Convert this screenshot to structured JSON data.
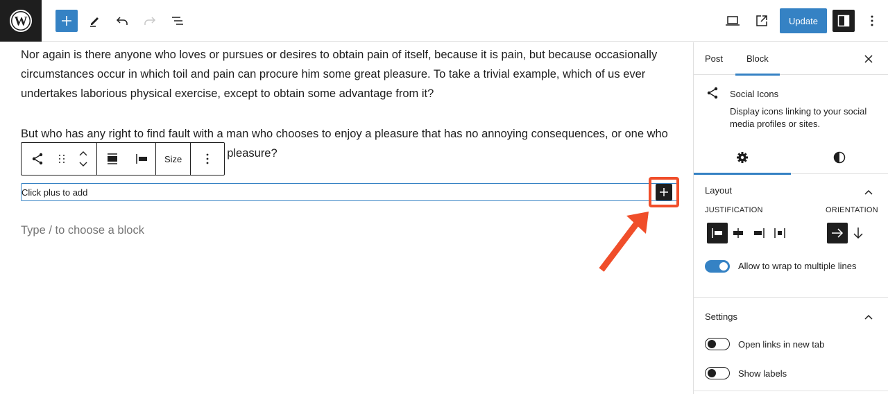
{
  "topbar": {
    "logo": "wordpress-logo",
    "inserter_icon": "plus-icon",
    "tools_icon": "pencil-icon",
    "undo_icon": "undo-icon",
    "redo_icon": "redo-icon",
    "list_view_icon": "list-view-icon",
    "preview_icon": "laptop-icon",
    "view_post_icon": "external-link-icon",
    "update_label": "Update",
    "settings_icon": "sidebar-toggle-icon",
    "options_icon": "more-vertical-icon"
  },
  "editor": {
    "paragraphs": [
      "Nor again is there anyone who loves or pursues or desires to obtain pain of itself, because it is pain, but because occasionally circumstances occur in which toil and pain can procure him some great pleasure. To take a trivial example, which of us ever undertakes laborious physical exercise, except to obtain some advantage from it?",
      "But who has any right to find fault with a man who chooses to enjoy a pleasure that has no annoying consequences, or one who avoids a pain that produces no resultant pleasure?"
    ],
    "block_toolbar": {
      "block_icon": "share-icon",
      "drag_icon": "drag-handle-icon",
      "move_icon": "chevron-up-down-icon",
      "align_icon": "align-wide-icon",
      "justify_icon": "justify-left-icon",
      "size_label": "Size",
      "options_icon": "more-vertical-icon"
    },
    "social_block_placeholder": "Click plus to add",
    "add_social_icon": "plus-icon",
    "appender_placeholder": "Type / to choose a block",
    "annotation_color": "#f04e2a"
  },
  "sidebar": {
    "tabs": [
      {
        "label": "Post",
        "active": false
      },
      {
        "label": "Block",
        "active": true
      }
    ],
    "close_icon": "close-icon",
    "block_card": {
      "icon": "share-icon",
      "title": "Social Icons",
      "description": "Display icons linking to your social media profiles or sites."
    },
    "sub_tabs": [
      {
        "icon": "gear-icon",
        "active": true
      },
      {
        "icon": "contrast-icon",
        "active": false
      }
    ],
    "layout_panel": {
      "title": "Layout",
      "justification_label": "Justification",
      "justification_options": [
        "justify-left",
        "justify-center",
        "justify-right",
        "justify-space-between"
      ],
      "justification_selected": "justify-left",
      "orientation_label": "Orientation",
      "orientation_options": [
        "horizontal",
        "vertical"
      ],
      "orientation_selected": "horizontal",
      "wrap_label": "Allow to wrap to multiple lines",
      "wrap_enabled": true
    },
    "settings_panel": {
      "title": "Settings",
      "toggles": [
        {
          "label": "Open links in new tab",
          "enabled": false
        },
        {
          "label": "Show labels",
          "enabled": false
        }
      ]
    }
  },
  "colors": {
    "accent": "#3582c4",
    "dark": "#1e1e1e",
    "annotation": "#f04e2a"
  }
}
